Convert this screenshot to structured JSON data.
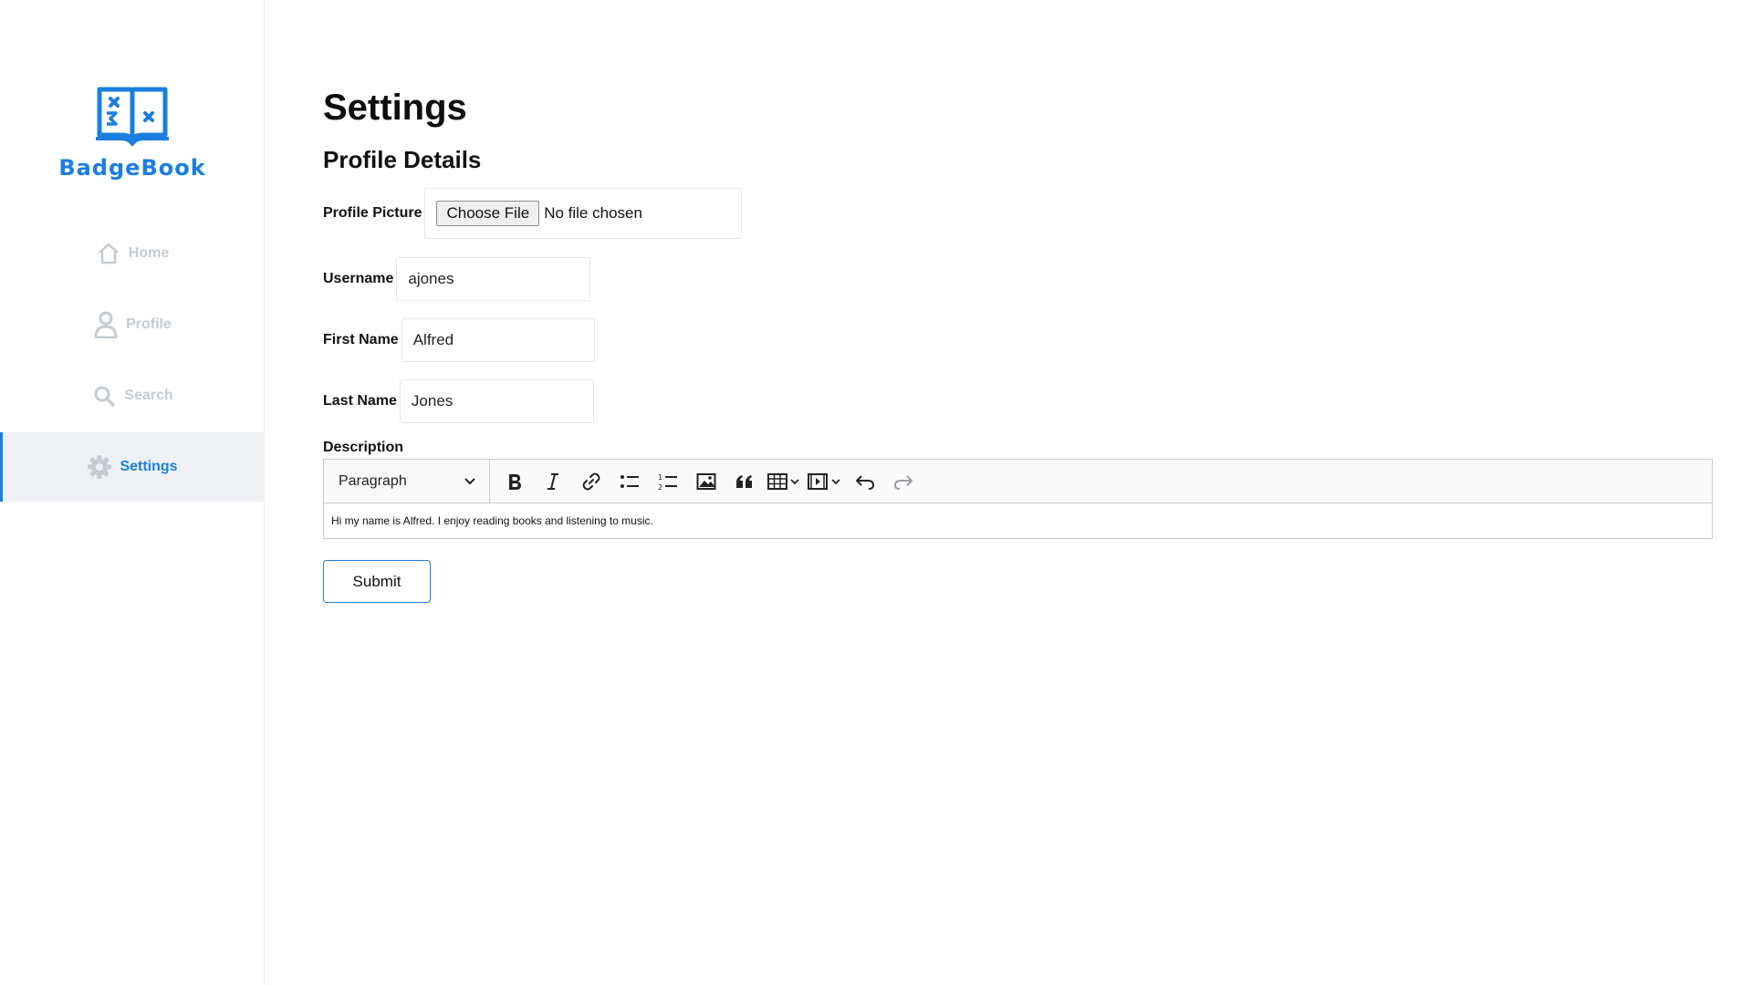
{
  "app": {
    "name": "BadgeBook"
  },
  "sidebar": {
    "items": [
      {
        "label": "Home",
        "icon": "home-icon"
      },
      {
        "label": "Profile",
        "icon": "user-icon"
      },
      {
        "label": "Search",
        "icon": "search-icon"
      },
      {
        "label": "Settings",
        "icon": "gear-icon",
        "active": true
      }
    ]
  },
  "main": {
    "title": "Settings",
    "section_title": "Profile Details",
    "profile_picture": {
      "label": "Profile Picture",
      "button_label": "Choose File",
      "status": "No file chosen"
    },
    "username": {
      "label": "Username",
      "value": "ajones"
    },
    "first_name": {
      "label": "First Name",
      "value": "Alfred"
    },
    "last_name": {
      "label": "Last Name",
      "value": "Jones"
    },
    "description": {
      "label": "Description",
      "heading_select": "Paragraph",
      "toolbar": [
        "bold-icon",
        "italic-icon",
        "link-icon",
        "bulleted-list-icon",
        "numbered-list-icon",
        "image-icon",
        "quote-icon",
        "table-icon",
        "media-icon",
        "undo-icon",
        "redo-icon"
      ],
      "content": "Hi my name is Alfred. I enjoy reading books and listening to music."
    },
    "submit_label": "Submit"
  },
  "colors": {
    "accent": "#1a7fe0",
    "nav_inactive": "#c6cbd2",
    "nav_active_bg": "#eef0f3"
  }
}
